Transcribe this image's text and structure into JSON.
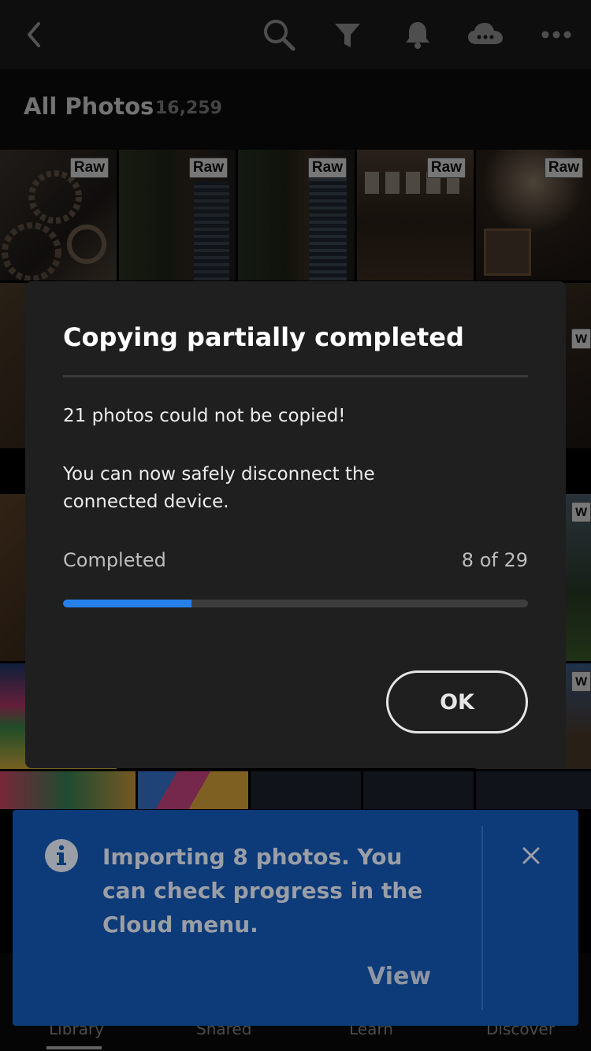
{
  "top_bar": {
    "icons": [
      "back-icon",
      "search-icon",
      "filter-icon",
      "bell-icon",
      "cloud-icon",
      "more-icon"
    ]
  },
  "album": {
    "title": "All Photos",
    "count": "16,259"
  },
  "grid": {
    "badge_label": "Raw",
    "partial_badge_label": "w"
  },
  "dialog": {
    "title": "Copying partially completed",
    "message_1": "21 photos could not be copied!",
    "message_2": "You can now safely disconnect the connected device.",
    "progress_label": "Completed",
    "progress_count": "8 of 29",
    "progress_fraction": 0.276,
    "ok_label": "OK"
  },
  "toast": {
    "message": "Importing 8 photos. You can check progress in the Cloud menu.",
    "action_label": "View"
  },
  "bottom_nav": {
    "items": [
      "Library",
      "Shared",
      "Learn",
      "Discover"
    ],
    "active": "Library"
  },
  "colors": {
    "accent": "#2680eb",
    "toast_bg": "#0d3a78",
    "dialog_bg": "#1f1f1f"
  }
}
